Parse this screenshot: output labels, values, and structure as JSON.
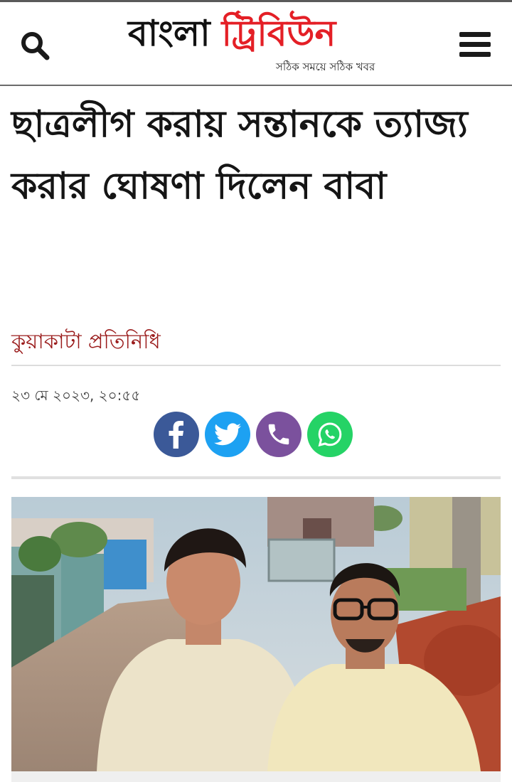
{
  "header": {
    "logo_part1": "বাংলা",
    "logo_part2": "ট্রিবিউন",
    "tagline": "সঠিক সময়ে সঠিক খবর",
    "search_icon": "search-icon",
    "menu_icon": "hamburger-menu-icon"
  },
  "article": {
    "headline": "ছাত্রলীগ করায় সন্তানকে ত্যাজ্য করার ঘোষণা দিলেন বাবা",
    "author": "কুয়াকাটা প্রতিনিধি",
    "date": "২৩ মে ২০২৩, ২০:৫৫"
  },
  "share_buttons": [
    {
      "name": "facebook",
      "icon": "facebook-icon",
      "color": "#3b5998"
    },
    {
      "name": "twitter",
      "icon": "twitter-icon",
      "color": "#1da1f2"
    },
    {
      "name": "viber",
      "icon": "viber-icon",
      "color": "#7b519d"
    },
    {
      "name": "whatsapp",
      "icon": "whatsapp-icon",
      "color": "#25d366"
    }
  ],
  "colors": {
    "brand_red": "#e41f26",
    "author_red": "#9a1b1b"
  }
}
